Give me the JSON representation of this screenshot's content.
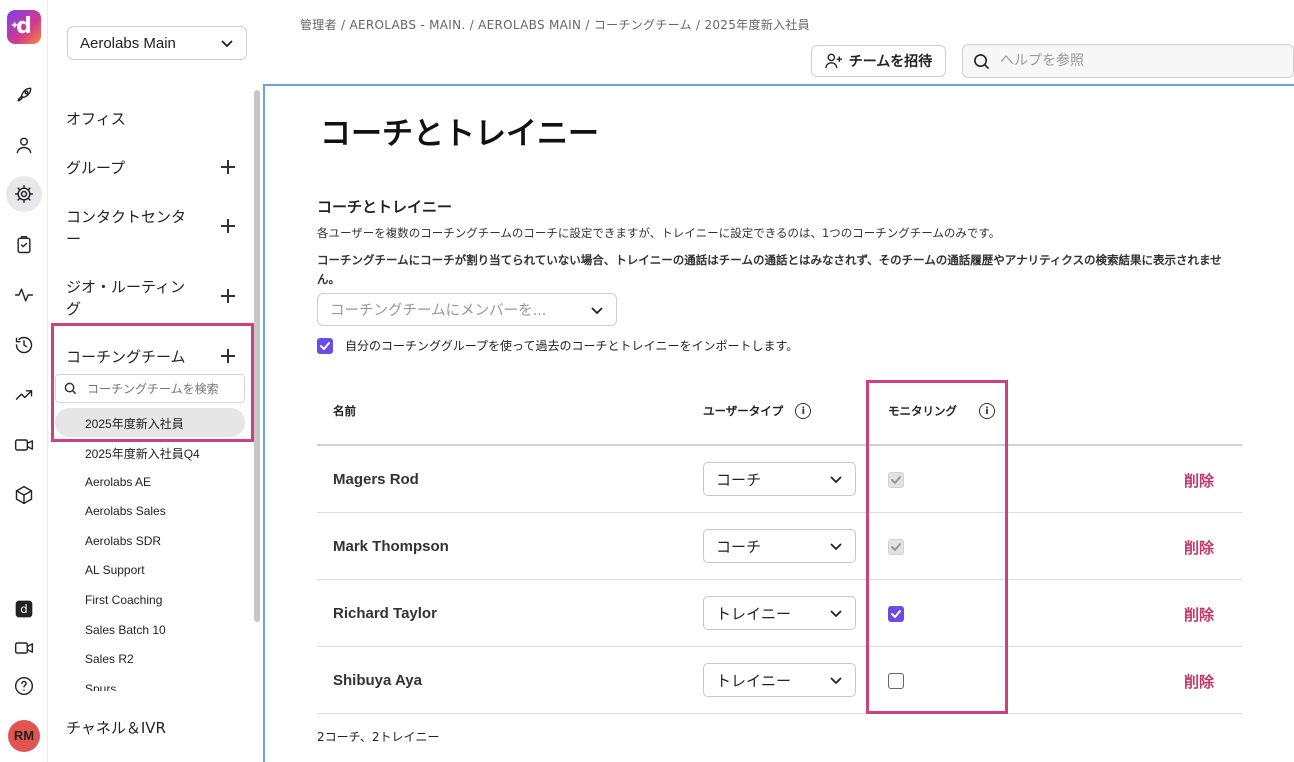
{
  "app": {
    "logo_letter": "d",
    "logo_spark": "✦",
    "user_initials": "RM"
  },
  "rail": {
    "icons": [
      "rocket-icon",
      "person-icon",
      "gear-icon",
      "clipboard-icon",
      "activity-icon",
      "history-icon",
      "trend-icon",
      "video-icon",
      "cube-icon",
      "dialpad-icon",
      "camera-icon",
      "help-icon"
    ]
  },
  "sidebar": {
    "workspace": "Aerolabs Main",
    "sections": {
      "office": "オフィス",
      "group": "グループ",
      "contact_center": "コンタクトセンター",
      "geo_routing": "ジオ・ルーティング",
      "coaching": "コーチングチーム",
      "channels": "チャネル＆IVR"
    },
    "search_placeholder": "コーチングチームを検索",
    "teams": [
      "2025年度新入社員",
      "2025年度新入社員Q4",
      "Aerolabs AE",
      "Aerolabs Sales",
      "Aerolabs SDR",
      "AL Support",
      "First Coaching",
      "Sales Batch 10",
      "Sales R2",
      "Spurs"
    ],
    "selected_team": "2025年度新入社員"
  },
  "header": {
    "breadcrumb": "管理者 / AEROLABS - MAIN. / AEROLABS MAIN / コーチングチーム / 2025年度新入社員",
    "invite_label": "チームを招待",
    "help_placeholder": "ヘルプを参照"
  },
  "main": {
    "title": "コーチとトレイニー",
    "section_title": "コーチとトレイニー",
    "description": "各ユーザーを複数のコーチングチームのコーチに設定できますが、トレイニーに設定できるのは、1つのコーチングチームのみです。",
    "warning": "コーチングチームにコーチが割り当てられていない場合、トレイニーの通話はチームの通話とはみなされず、そのチームの通話履歴やアナリティクスの検索結果に表示されません。",
    "member_select_placeholder": "コーチングチームにメンバーを...",
    "import_label": "自分のコーチンググループを使って過去のコーチとトレイニーをインポートします。",
    "import_checked": true,
    "columns": {
      "name": "名前",
      "user_type": "ユーザータイプ",
      "monitoring": "モニタリング"
    },
    "rows": [
      {
        "name": "Magers Rod",
        "type": "コーチ",
        "monitoring": "checked-disabled",
        "delete": "削除"
      },
      {
        "name": "Mark Thompson",
        "type": "コーチ",
        "monitoring": "checked-disabled",
        "delete": "削除"
      },
      {
        "name": "Richard Taylor",
        "type": "トレイニー",
        "monitoring": "checked",
        "delete": "削除"
      },
      {
        "name": "Shibuya Aya",
        "type": "トレイニー",
        "monitoring": "unchecked",
        "delete": "削除"
      }
    ],
    "summary": "2コーチ、2トレイニー"
  },
  "colors": {
    "accent": "#6a4de8",
    "highlight": "#d0417c",
    "delete": "#c23a6a"
  }
}
